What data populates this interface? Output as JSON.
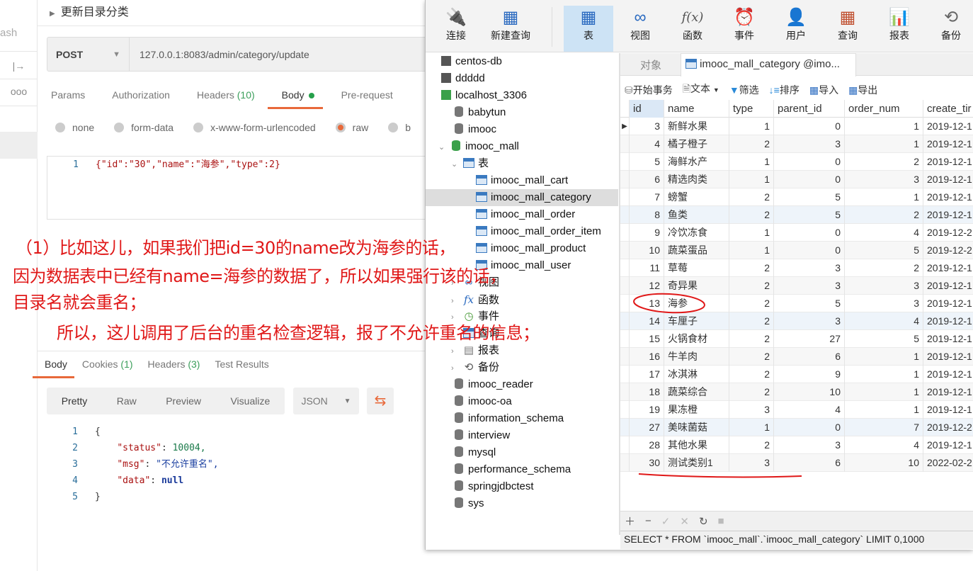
{
  "postman": {
    "sidebar_text": "ash",
    "request_title": "更新目录分类",
    "method": "POST",
    "url": "127.0.0.1:8083/admin/category/update",
    "req_tabs": [
      {
        "label": "Params"
      },
      {
        "label": "Authorization"
      },
      {
        "label": "Headers",
        "count": "(10)"
      },
      {
        "label": "Body"
      },
      {
        "label": "Pre-request"
      }
    ],
    "body_types": [
      "none",
      "form-data",
      "x-www-form-urlencoded",
      "raw",
      "b"
    ],
    "request_body": {
      "line": "1",
      "text": "{\"id\":\"30\",\"name\":\"海参\",\"type\":2}"
    },
    "res_tabs": [
      {
        "label": "Body"
      },
      {
        "label": "Cookies",
        "count": "(1)"
      },
      {
        "label": "Headers",
        "count": "(3)"
      },
      {
        "label": "Test Results"
      }
    ],
    "formats": [
      "Pretty",
      "Raw",
      "Preview",
      "Visualize"
    ],
    "format_select": "JSON",
    "response_lines": [
      {
        "n": "1",
        "k": "",
        "v": "{"
      },
      {
        "n": "2",
        "k": "\"status\"",
        "v": "10004,"
      },
      {
        "n": "3",
        "k": "\"msg\"",
        "v": "\"不允许重名\","
      },
      {
        "n": "4",
        "k": "\"data\"",
        "v": "null"
      },
      {
        "n": "5",
        "k": "",
        "v": "}"
      }
    ]
  },
  "navicat": {
    "toolbar": [
      "连接",
      "新建查询",
      "表",
      "视图",
      "函数",
      "事件",
      "用户",
      "查询",
      "报表",
      "备份"
    ],
    "tree": [
      "centos-db",
      "ddddd",
      "localhost_3306",
      "babytun",
      "imooc",
      "imooc_mall",
      "表",
      "imooc_mall_cart",
      "imooc_mall_category",
      "imooc_mall_order",
      "imooc_mall_order_item",
      "imooc_mall_product",
      "imooc_mall_user",
      "视图",
      "函数",
      "事件",
      "查询",
      "报表",
      "备份",
      "imooc_reader",
      "imooc-oa",
      "information_schema",
      "interview",
      "mysql",
      "performance_schema",
      "springjdbctest",
      "sys"
    ],
    "tabs": {
      "objects": "对象",
      "active": "imooc_mall_category @imo..."
    },
    "data_toolbar": [
      "开始事务",
      "文本",
      "筛选",
      "排序",
      "导入",
      "导出"
    ],
    "columns": [
      "id",
      "name",
      "type",
      "parent_id",
      "order_num",
      "create_tir"
    ],
    "rows": [
      [
        "3",
        "新鲜水果",
        "1",
        "0",
        "1",
        "2019-12-1"
      ],
      [
        "4",
        "橘子橙子",
        "2",
        "3",
        "1",
        "2019-12-1"
      ],
      [
        "5",
        "海鲜水产",
        "1",
        "0",
        "2",
        "2019-12-1"
      ],
      [
        "6",
        "精选肉类",
        "1",
        "0",
        "3",
        "2019-12-1"
      ],
      [
        "7",
        "螃蟹",
        "2",
        "5",
        "1",
        "2019-12-1"
      ],
      [
        "8",
        "鱼类",
        "2",
        "5",
        "2",
        "2019-12-1"
      ],
      [
        "9",
        "冷饮冻食",
        "1",
        "0",
        "4",
        "2019-12-2"
      ],
      [
        "10",
        "蔬菜蛋品",
        "1",
        "0",
        "5",
        "2019-12-2"
      ],
      [
        "11",
        "草莓",
        "2",
        "3",
        "2",
        "2019-12-1"
      ],
      [
        "12",
        "奇异果",
        "2",
        "3",
        "3",
        "2019-12-1"
      ],
      [
        "13",
        "海参",
        "2",
        "5",
        "3",
        "2019-12-1"
      ],
      [
        "14",
        "车厘子",
        "2",
        "3",
        "4",
        "2019-12-1"
      ],
      [
        "15",
        "火锅食材",
        "2",
        "27",
        "5",
        "2019-12-1"
      ],
      [
        "16",
        "牛羊肉",
        "2",
        "6",
        "1",
        "2019-12-1"
      ],
      [
        "17",
        "冰淇淋",
        "2",
        "9",
        "1",
        "2019-12-1"
      ],
      [
        "18",
        "蔬菜综合",
        "2",
        "10",
        "1",
        "2019-12-1"
      ],
      [
        "19",
        "果冻橙",
        "3",
        "4",
        "1",
        "2019-12-1"
      ],
      [
        "27",
        "美味菌菇",
        "1",
        "0",
        "7",
        "2019-12-2"
      ],
      [
        "28",
        "其他水果",
        "2",
        "3",
        "4",
        "2019-12-1"
      ],
      [
        "30",
        "测试类别1",
        "3",
        "6",
        "10",
        "2022-02-2"
      ]
    ],
    "sql": "SELECT * FROM `imooc_mall`.`imooc_mall_category` LIMIT 0,1000"
  },
  "annotation": [
    "（1）比如这儿，如果我们把id=30的name改为海参的话，",
    "因为数据表中已经有name=海参的数据了，所以如果强行该的话，",
    "目录名就会重名；",
    "所以，这儿调用了后台的重名检查逻辑，报了不允许重名的信息；"
  ],
  "colors": {
    "accent": "#e8693a",
    "annotation": "#e01818"
  }
}
